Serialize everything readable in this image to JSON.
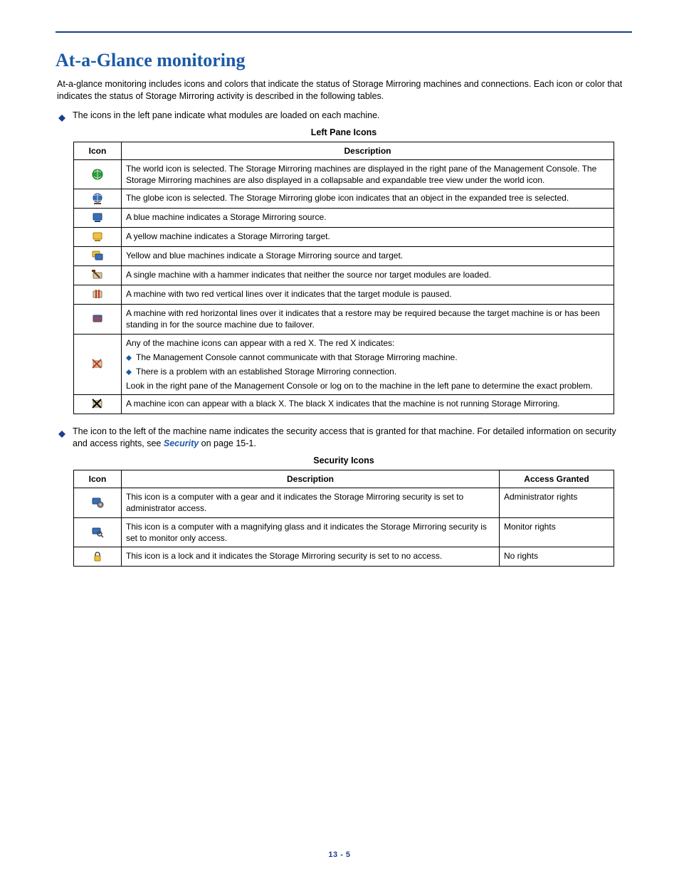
{
  "heading": "At-a-Glance monitoring",
  "intro": "At-a-glance monitoring includes icons and colors that indicate the status of Storage Mirroring machines and connections. Each icon or color that indicates the status of Storage Mirroring activity is described in the following tables.",
  "bullet1": "The icons in the left pane indicate what modules are loaded on each machine.",
  "table1_title": "Left Pane Icons",
  "table1": {
    "headers": {
      "icon": "Icon",
      "desc": "Description"
    },
    "rows": [
      {
        "icon_name": "world-icon",
        "desc": "The world icon is selected. The Storage Mirroring machines are displayed in the right pane of the Management Console. The Storage Mirroring machines are also displayed in a collapsable and expandable tree view under the world icon."
      },
      {
        "icon_name": "globe-icon",
        "desc": "The globe icon is selected. The Storage Mirroring globe icon indicates that an object in the expanded tree is selected."
      },
      {
        "icon_name": "machine-blue-icon",
        "desc": "A blue machine indicates a Storage Mirroring source."
      },
      {
        "icon_name": "machine-yellow-icon",
        "desc": "A yellow machine indicates a Storage Mirroring target."
      },
      {
        "icon_name": "machine-blue-yellow-icon",
        "desc": "Yellow and blue machines indicate a Storage Mirroring source and target."
      },
      {
        "icon_name": "machine-hammer-icon",
        "desc": "A single machine with a hammer indicates that neither the source nor target modules are loaded."
      },
      {
        "icon_name": "machine-paused-icon",
        "desc": "A machine with two red vertical lines over it indicates that the target module is paused."
      },
      {
        "icon_name": "machine-restore-icon",
        "desc": "A machine with red horizontal lines over it indicates that a restore may be required because the target machine is or has been standing in for the source machine due to failover."
      },
      {
        "icon_name": "machine-red-x-icon",
        "complex": {
          "line1": "Any of the machine icons can appear with a red X. The red X indicates:",
          "sub1": "The Management Console cannot communicate with that Storage Mirroring machine.",
          "sub2": "There is a problem with an established Storage Mirroring connection.",
          "line2": "Look in the right pane of the Management Console or log on to the machine in the left pane to determine the exact problem."
        }
      },
      {
        "icon_name": "machine-black-x-icon",
        "desc": "A machine icon can appear with a black X. The black X indicates that the machine is not running Storage Mirroring."
      }
    ]
  },
  "bullet2_prefix": "The icon to the left of the machine name indicates the security access that is granted for that machine. For detailed information on security and access rights, see ",
  "bullet2_link": "Security",
  "bullet2_suffix": " on page 15-1.",
  "table2_title": "Security Icons",
  "table2": {
    "headers": {
      "icon": "Icon",
      "desc": "Description",
      "access": "Access Granted"
    },
    "rows": [
      {
        "icon_name": "security-admin-icon",
        "desc": "This icon is a computer with a gear and it indicates the Storage Mirroring security is set to administrator access.",
        "access": "Administrator rights"
      },
      {
        "icon_name": "security-monitor-icon",
        "desc": "This icon is a computer with a magnifying glass and it indicates the Storage Mirroring security is set to monitor only access.",
        "access": "Monitor rights"
      },
      {
        "icon_name": "security-lock-icon",
        "desc": "This icon is a lock and it indicates the Storage Mirroring security is set to no access.",
        "access": "No rights"
      }
    ]
  },
  "footer": "13 - 5",
  "icon_svg": {
    "world-icon": "<circle cx='9' cy='9' r='7' fill='#2a9d3a' stroke='#176b22'/><path d='M4 6 Q9 2 14 6 M4 12 Q9 16 14 12 M9 2 V16' stroke='#cfe8d2' stroke-width='1' fill='none'/>",
    "globe-icon": "<circle cx='9' cy='8' r='6' fill='#3a6fb0' stroke='#1b3f8b'/><path d='M4 5 Q9 2 14 5 M4 11 Q9 14 14 11 M9 2 V14' stroke='#cfe0f2' stroke-width='1' fill='none'/><rect x='4' y='15' width='10' height='2' fill='#6b4a1b'/>",
    "machine-blue-icon": "<rect x='3' y='3' width='12' height='9' rx='1' fill='#3a6fb0' stroke='#1b3f8b'/><rect x='5' y='13' width='8' height='2' fill='#1b3f8b'/>",
    "machine-yellow-icon": "<rect x='3' y='3' width='12' height='9' rx='1' fill='#f0c23a' stroke='#a67c1b'/><rect x='5' y='13' width='8' height='2' fill='#a67c1b'/>",
    "machine-blue-yellow-icon": "<rect x='2' y='2' width='10' height='8' rx='1' fill='#f0c23a' stroke='#a67c1b'/><rect x='6' y='6' width='10' height='8' rx='1' fill='#3a6fb0' stroke='#1b3f8b'/>",
    "machine-hammer-icon": "<rect x='3' y='5' width='12' height='8' rx='1' fill='#d6c9a6' stroke='#8a7a4a'/><line x1='3' y1='3' x2='12' y2='12' stroke='#5a3b1b' stroke-width='2'/><rect x='1' y='1' width='5' height='3' fill='#5a3b1b'/>",
    "machine-paused-icon": "<rect x='3' y='4' width='12' height='9' rx='1' fill='#d6c9a6' stroke='#8a7a4a'/><line x1='7' y1='2' x2='7' y2='14' stroke='#c0392b' stroke-width='2'/><line x1='11' y1='2' x2='11' y2='14' stroke='#c0392b' stroke-width='2'/>",
    "machine-restore-icon": "<rect x='3' y='4' width='12' height='9' rx='1' fill='#3a6fb0' stroke='#1b3f8b'/><line x1='3' y1='6' x2='15' y2='6' stroke='#c0392b' stroke-width='1.5'/><line x1='3' y1='9' x2='15' y2='9' stroke='#c0392b' stroke-width='1.5'/><line x1='3' y1='12' x2='15' y2='12' stroke='#c0392b' stroke-width='1.5'/>",
    "machine-red-x-icon": "<rect x='3' y='4' width='12' height='9' rx='1' fill='#d6c9a6' stroke='#8a7a4a'/><line x1='2' y1='2' x2='14' y2='14' stroke='#c0392b' stroke-width='2'/><line x1='14' y1='2' x2='2' y2='14' stroke='#c0392b' stroke-width='2'/>",
    "machine-black-x-icon": "<rect x='3' y='4' width='12' height='9' rx='1' fill='#d6c9a6' stroke='#8a7a4a'/><line x1='2' y1='2' x2='14' y2='14' stroke='#000' stroke-width='2'/><line x1='14' y1='2' x2='2' y2='14' stroke='#000' stroke-width='2'/>",
    "security-admin-icon": "<rect x='2' y='3' width='11' height='8' rx='1' fill='#3a6fb0' stroke='#1b3f8b'/><circle cx='13' cy='12' r='4' fill='#888' stroke='#444'/><circle cx='13' cy='12' r='1.5' fill='#ccc'/>",
    "security-monitor-icon": "<rect x='2' y='3' width='11' height='8' rx='1' fill='#3a6fb0' stroke='#1b3f8b'/><circle cx='12' cy='11' r='3' fill='none' stroke='#444' stroke-width='1.5'/><line x1='14' y1='13' x2='17' y2='16' stroke='#444' stroke-width='1.5'/>",
    "security-lock-icon": "<rect x='5' y='8' width='8' height='7' rx='1' fill='#f0c23a' stroke='#a67c1b'/><path d='M6 8 V6 a3 3 0 0 1 6 0 V8' fill='none' stroke='#444' stroke-width='1.5'/>"
  }
}
